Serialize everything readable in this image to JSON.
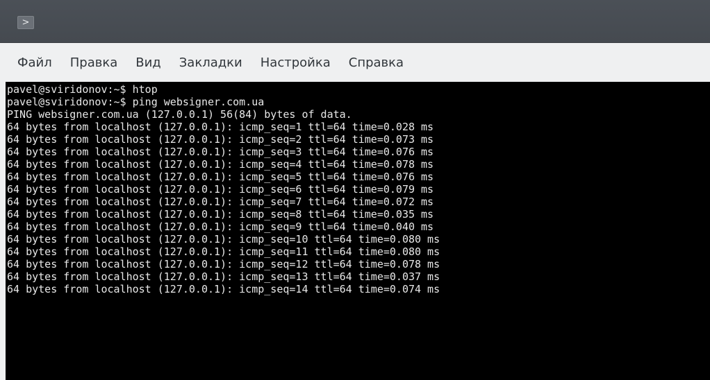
{
  "window": {
    "icon": ">",
    "colors": {
      "titlebar": "#474c52",
      "menubar": "#eff0f1",
      "terminal_bg": "#000000",
      "terminal_fg": "#e8e8e8"
    }
  },
  "menubar": {
    "items": [
      {
        "label": "Файл"
      },
      {
        "label": "Правка"
      },
      {
        "label": "Вид"
      },
      {
        "label": "Закладки"
      },
      {
        "label": "Настройка"
      },
      {
        "label": "Справка"
      }
    ]
  },
  "terminal": {
    "lines": [
      "pavel@sviridonov:~$ htop",
      "pavel@sviridonov:~$ ping websigner.com.ua",
      "PING websigner.com.ua (127.0.0.1) 56(84) bytes of data.",
      "64 bytes from localhost (127.0.0.1): icmp_seq=1 ttl=64 time=0.028 ms",
      "64 bytes from localhost (127.0.0.1): icmp_seq=2 ttl=64 time=0.073 ms",
      "64 bytes from localhost (127.0.0.1): icmp_seq=3 ttl=64 time=0.076 ms",
      "64 bytes from localhost (127.0.0.1): icmp_seq=4 ttl=64 time=0.078 ms",
      "64 bytes from localhost (127.0.0.1): icmp_seq=5 ttl=64 time=0.076 ms",
      "64 bytes from localhost (127.0.0.1): icmp_seq=6 ttl=64 time=0.079 ms",
      "64 bytes from localhost (127.0.0.1): icmp_seq=7 ttl=64 time=0.072 ms",
      "64 bytes from localhost (127.0.0.1): icmp_seq=8 ttl=64 time=0.035 ms",
      "64 bytes from localhost (127.0.0.1): icmp_seq=9 ttl=64 time=0.040 ms",
      "64 bytes from localhost (127.0.0.1): icmp_seq=10 ttl=64 time=0.080 ms",
      "64 bytes from localhost (127.0.0.1): icmp_seq=11 ttl=64 time=0.080 ms",
      "64 bytes from localhost (127.0.0.1): icmp_seq=12 ttl=64 time=0.078 ms",
      "64 bytes from localhost (127.0.0.1): icmp_seq=13 ttl=64 time=0.037 ms",
      "64 bytes from localhost (127.0.0.1): icmp_seq=14 ttl=64 time=0.074 ms"
    ]
  }
}
